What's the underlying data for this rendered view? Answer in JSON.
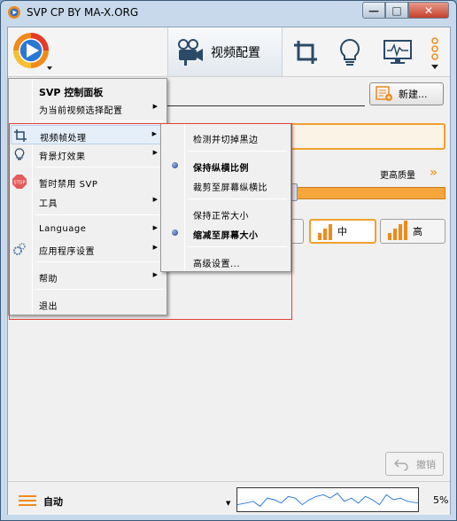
{
  "window": {
    "title": "SVP CP BY MA-X.ORG",
    "min_label": "—",
    "max_label": "□",
    "close_label": "✕"
  },
  "toolbar": {
    "active_tab_label": "视频配置",
    "icons": [
      "film-camera-icon",
      "crop-icon",
      "lightbulb-icon",
      "monitor-icon",
      "more-icon"
    ]
  },
  "main": {
    "new_button_label": "新建...",
    "quality_label": "更高质量",
    "quality_arrows": "»",
    "quality_buttons": {
      "mid": "中",
      "high": "高"
    },
    "undo_label": "撤销"
  },
  "status": {
    "mode_label": "自动",
    "cpu_percent": "5%"
  },
  "menu_main": {
    "items": [
      {
        "label": "SVP 控制面板",
        "bold": true
      },
      {
        "label": "为当前视频选择配置",
        "arrow": "▶"
      },
      {
        "label": "视频帧处理",
        "arrow": "▶",
        "icon": "crop-icon"
      },
      {
        "label": "背景灯效果",
        "arrow": "▶",
        "icon": "lightbulb-icon"
      },
      {
        "label": "暂时禁用 SVP",
        "icon": "stop-icon",
        "icon_text": "STOP"
      },
      {
        "label": "工具",
        "arrow": "▶"
      },
      {
        "label": "Language",
        "arrow": "▶"
      },
      {
        "label": "应用程序设置",
        "arrow": "▶",
        "icon": "gears-icon"
      },
      {
        "label": "帮助",
        "arrow": "▶"
      },
      {
        "label": "退出"
      }
    ]
  },
  "menu_sub": {
    "items": [
      {
        "label": "检测并切掉黑边"
      },
      {
        "label": "保持纵横比例",
        "checked": true
      },
      {
        "label": "裁剪至屏幕纵横比"
      },
      {
        "label": "保持正常大小"
      },
      {
        "label": "缩减至屏幕大小",
        "checked": true
      },
      {
        "label": "高级设置..."
      }
    ]
  },
  "colors": {
    "accent": "#f0a030",
    "highlight_outline": "#e2413a",
    "radio_dot": "#1e3e8c"
  }
}
